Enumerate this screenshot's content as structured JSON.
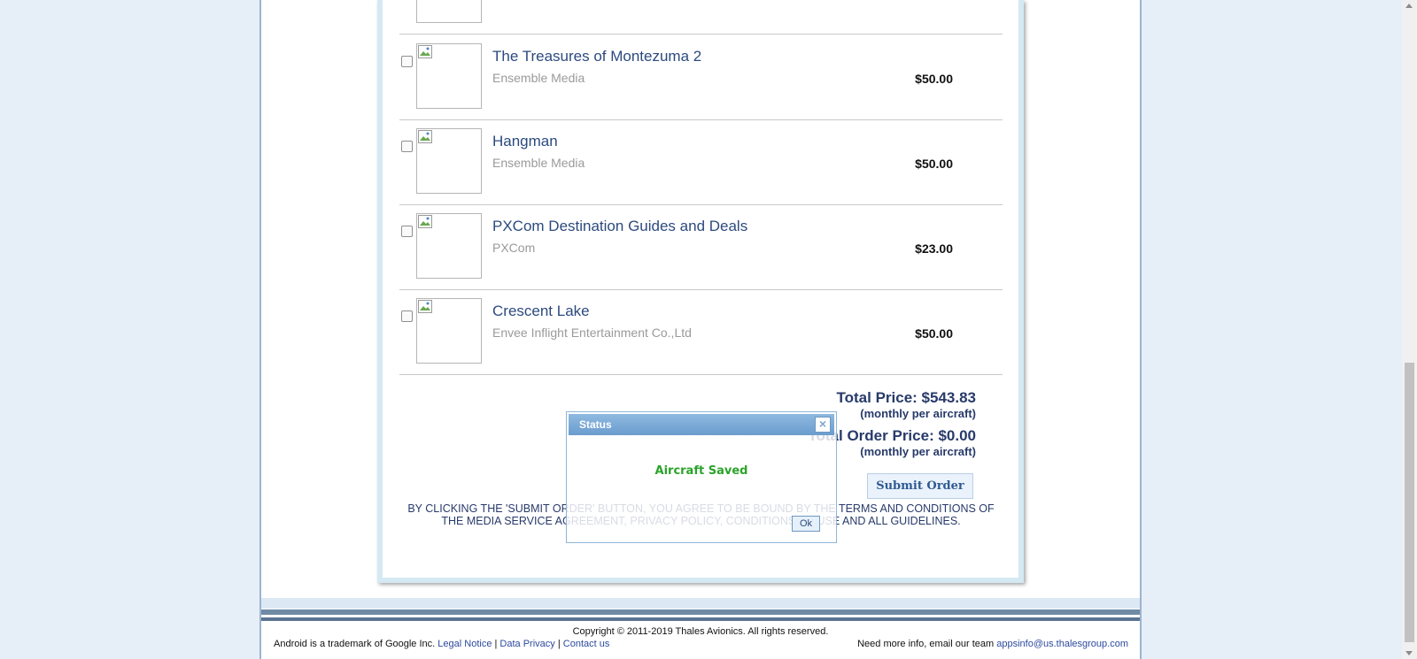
{
  "products": [
    {
      "title": "The Treasures of Montezuma 2",
      "vendor": "Ensemble Media",
      "price": "$50.00",
      "checked": false
    },
    {
      "title": "Hangman",
      "vendor": "Ensemble Media",
      "price": "$50.00",
      "checked": false
    },
    {
      "title": "PXCom Destination Guides and Deals",
      "vendor": "PXCom",
      "price": "$23.00",
      "checked": false
    },
    {
      "title": "Crescent Lake",
      "vendor": "Envee Inflight Entertainment Co.,Ltd",
      "price": "$50.00",
      "checked": false
    }
  ],
  "totals": {
    "total_price": "Total Price: $543.83",
    "total_price_note": "(monthly per aircraft)",
    "total_order_price": "Total Order Price: $0.00",
    "total_order_note": "(monthly per aircraft)"
  },
  "submit_label": "Submit Order",
  "agreement_line1": "BY CLICKING THE 'SUBMIT ORDER' BUTTON, YOU AGREE TO BE BOUND BY THE TERMS AND CONDITIONS OF",
  "agreement_line2": "THE MEDIA SERVICE AGREEMENT, PRIVACY POLICY, CONDITIONS OF USE AND ALL GUIDELINES.",
  "modal": {
    "title": "Status",
    "message": "Aircraft Saved",
    "ok_label": "Ok",
    "close_glyph": "×"
  },
  "footer": {
    "copyright": "Copyright © 2011-2019 Thales Avionics. All rights reserved.",
    "android_notice": "Android is a trademark of Google Inc.",
    "legal_notice": "Legal Notice",
    "data_privacy": "Data Privacy",
    "contact_us": "Contact us",
    "separator": "|",
    "need_info": "Need more info, email our team",
    "email": "appsinfo@us.thalesgroup.com"
  },
  "icons": {
    "thumbnail": "broken-image-icon",
    "scroll_up": "scroll-up-arrow-icon",
    "scroll_down": "scroll-down-arrow-icon"
  }
}
